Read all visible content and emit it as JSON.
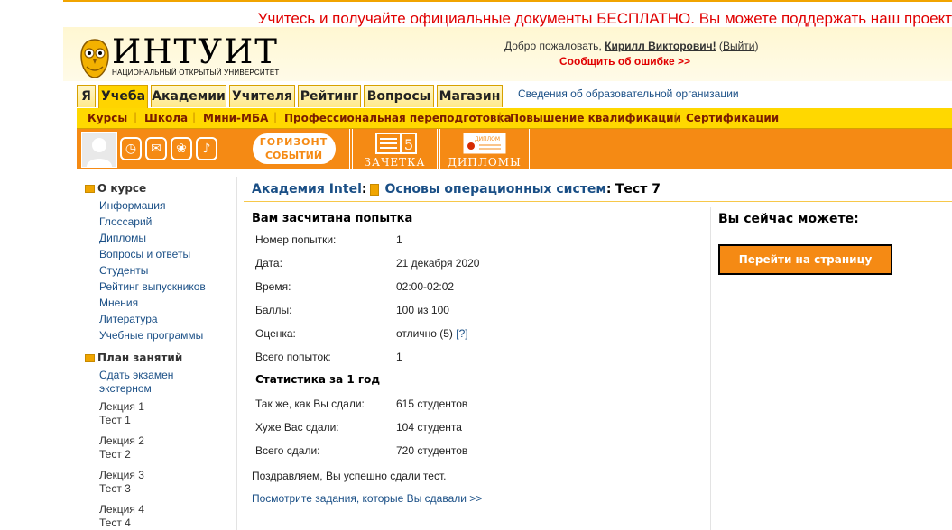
{
  "banner": {
    "text": "Учитесь и получайте официальные документы БЕСПЛАТНО. Вы можете поддержать наш проект"
  },
  "logo": {
    "name": "ИНТУИТ",
    "subtitle": "НАЦИОНАЛЬНЫЙ ОТКРЫТЫЙ УНИВЕРСИТЕТ",
    "icon": "owl-logo-icon"
  },
  "header": {
    "welcome_prefix": "Добро пожаловать,",
    "user_name": "Кирилл Викторович!",
    "logout_label": "Выйти",
    "report_error": "Сообщить об ошибке >>"
  },
  "tabs": [
    {
      "label": "Я"
    },
    {
      "label": "Учеба"
    },
    {
      "label": "Академии"
    },
    {
      "label": "Учителя"
    },
    {
      "label": "Рейтинг"
    },
    {
      "label": "Вопросы"
    },
    {
      "label": "Магазин"
    }
  ],
  "org_info_link": "Сведения об образовательной организации",
  "subnav": [
    {
      "label": "Курсы"
    },
    {
      "label": "Школа"
    },
    {
      "label": "Мини-МБА"
    },
    {
      "label": "Профессиональная переподготовка"
    },
    {
      "label": "Повышение квалификации"
    },
    {
      "label": "Сертификации"
    }
  ],
  "quick_icons": [
    "alarm-clock-icon",
    "envelope-icon",
    "gift-icon",
    "bell-icon"
  ],
  "orange_bar": {
    "horizon_line1": "ГОРИЗОНТ",
    "horizon_line2": "СОБЫТИЙ",
    "zachetka_label": "ЗАЧЕТКА",
    "zachetka_number": "5",
    "diplomas_label": "ДИПЛОМЫ",
    "diploma_card_text": "ДИПЛОМ"
  },
  "sidebar": {
    "about": {
      "title": "О курсе",
      "items": [
        "Информация",
        "Глоссарий",
        "Дипломы",
        "Вопросы и ответы",
        "Студенты",
        "Рейтинг выпускников",
        "Мнения",
        "Литература",
        "Учебные программы"
      ]
    },
    "plan": {
      "title": "План занятий",
      "exam_line1": "Сдать экзамен",
      "exam_line2": "экстерном",
      "lectures": [
        {
          "lecture": "Лекция 1",
          "test": "Тест 1"
        },
        {
          "lecture": "Лекция 2",
          "test": "Тест 2"
        },
        {
          "lecture": "Лекция 3",
          "test": "Тест 3"
        },
        {
          "lecture": "Лекция 4",
          "test": "Тест 4"
        }
      ]
    }
  },
  "breadcrumb": {
    "academy": "Академия Intel",
    "separator": ":",
    "course": "Основы операционных систем",
    "separator2": ":",
    "current": "Тест 7"
  },
  "result": {
    "title": "Вам засчитана попытка",
    "rows": [
      {
        "label": "Номер попытки:",
        "value": "1"
      },
      {
        "label": "Дата:",
        "value": "21 декабря 2020"
      },
      {
        "label": "Время:",
        "value": "02:00-02:02"
      },
      {
        "label": "Баллы:",
        "value": "100 из 100"
      },
      {
        "label": "Оценка:",
        "value": "отлично (5)",
        "help": "[?]"
      },
      {
        "label": "Всего попыток:",
        "value": "1"
      }
    ],
    "stats_title": "Статистика за 1 год",
    "stats": [
      {
        "label": "Так же, как Вы сдали:",
        "value": "615 студентов"
      },
      {
        "label": "Хуже Вас сдали:",
        "value": "104 студента"
      },
      {
        "label": "Всего сдали:",
        "value": "720 студентов"
      }
    ],
    "congrats": "Поздравляем, Вы успешно сдали тест.",
    "view_tasks": "Посмотрите задания, которые Вы сдавали >>"
  },
  "right_panel": {
    "title": "Вы сейчас можете:",
    "button_label": "Перейти на страницу курса"
  }
}
